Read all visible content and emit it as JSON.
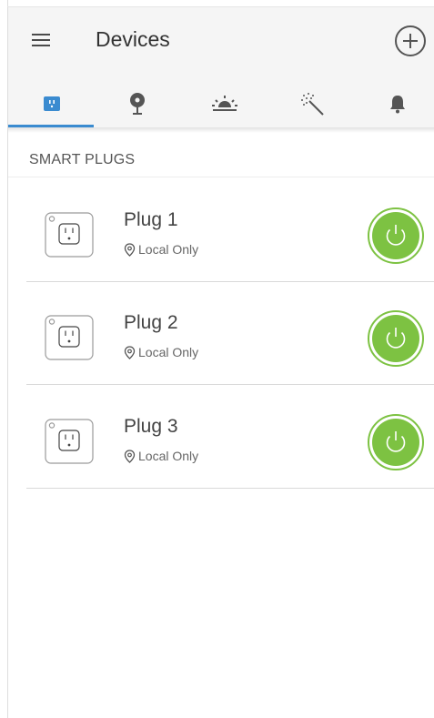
{
  "header": {
    "title": "Devices"
  },
  "tabs": [
    {
      "icon": "smart-plug-icon",
      "active": true
    },
    {
      "icon": "camera-icon",
      "active": false
    },
    {
      "icon": "sunrise-icon",
      "active": false
    },
    {
      "icon": "magic-wand-icon",
      "active": false
    },
    {
      "icon": "bell-icon",
      "active": false
    }
  ],
  "section": {
    "label": "SMART PLUGS"
  },
  "devices": [
    {
      "name": "Plug 1",
      "status": "Local Only",
      "power": "on"
    },
    {
      "name": "Plug 2",
      "status": "Local Only",
      "power": "on"
    },
    {
      "name": "Plug 3",
      "status": "Local Only",
      "power": "on"
    }
  ],
  "colors": {
    "accent": "#3a8bd0",
    "power_on": "#7dc242",
    "header_bg": "#f5f5f5"
  }
}
